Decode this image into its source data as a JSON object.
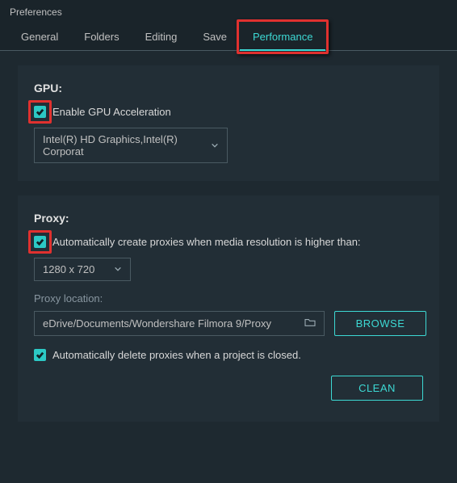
{
  "window": {
    "title": "Preferences"
  },
  "tabs": {
    "general": "General",
    "folders": "Folders",
    "editing": "Editing",
    "save": "Save",
    "performance": "Performance"
  },
  "gpu": {
    "title": "GPU:",
    "enable_label": "Enable GPU Acceleration",
    "device": "Intel(R) HD Graphics,Intel(R) Corporat"
  },
  "proxy": {
    "title": "Proxy:",
    "auto_create_label": "Automatically create proxies when media resolution is higher than:",
    "resolution": "1280 x 720",
    "location_label": "Proxy location:",
    "path": "eDrive/Documents/Wondershare Filmora 9/Proxy",
    "browse": "BROWSE",
    "auto_delete_label": "Automatically delete proxies when a project is closed.",
    "clean": "CLEAN"
  }
}
